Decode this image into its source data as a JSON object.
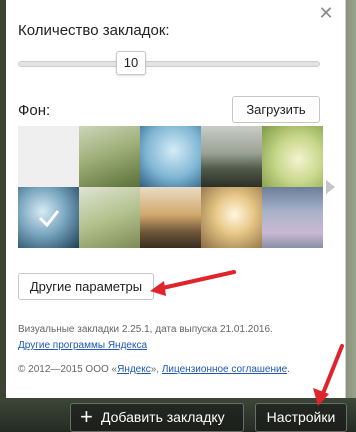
{
  "panel": {
    "count_label": "Количество закладок:",
    "count_value": "10",
    "background_label": "Фон:",
    "upload_label": "Загрузить",
    "more_params_label": "Другие параметры",
    "version_text": "Визуальные закладки 2.25.1, дата выпуска 21.01.2016.",
    "other_programs_link": "Другие программы Яндекса",
    "copyright_prefix": "© 2012—2015 ООО «",
    "yandex_link": "Яндекс",
    "copyright_sep": "», ",
    "license_link": "Лицензионное соглашение",
    "copyright_end": ".",
    "close_icon": "close-icon",
    "selected_tile_index": 5
  },
  "bottom_bar": {
    "add_bookmark_label": "Добавить закладку",
    "settings_label": "Настройки"
  },
  "colors": {
    "link": "#1f57b5",
    "annotation_arrow": "#e0242b"
  }
}
